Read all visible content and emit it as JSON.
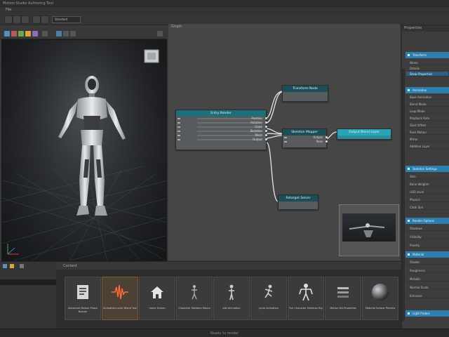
{
  "window": {
    "title": "Motion Studio Authoring Tool"
  },
  "menu": {
    "first_item": "File"
  },
  "toolbar": {
    "layout_value": "Standard"
  },
  "graph": {
    "tab_label": "Graph",
    "nodes": [
      {
        "id": "main",
        "title": "Entry Render"
      },
      {
        "id": "top",
        "title": "Transform Node"
      },
      {
        "id": "mid",
        "title": "Skeleton Mapper"
      },
      {
        "id": "out",
        "title": "Output Blend Layer"
      },
      {
        "id": "bottom",
        "title": "Retarget Solver"
      }
    ],
    "main_pins": [
      "Position",
      "Rotation",
      "Scale",
      "Skeleton",
      "Mesh",
      "Output"
    ],
    "mid_pins": [
      "Output",
      "Pose"
    ]
  },
  "viewport": {
    "label": "Perspective"
  },
  "properties": {
    "title": "Properties",
    "sections": [
      {
        "label": "Transform",
        "props": [
          "Name",
          "Details",
          "Show Properties"
        ]
      },
      {
        "label": "Animation",
        "props": [
          "Base Animation",
          "Blend Mode",
          "Loop Mode",
          "Playback Rate",
          "Start Offset",
          "Root Motion",
          "Mirror",
          "Additive Layer"
        ]
      },
      {
        "label": "Skeleton Settings",
        "props": [
          "Skin",
          "Bone Weights",
          "LOD Level",
          "Physics",
          "Cloth Sim"
        ]
      },
      {
        "label": "Render Options",
        "props": [
          "Shadows",
          "Visibility",
          "Priority"
        ]
      },
      {
        "label": "Material",
        "props": [
          "Shader",
          "Roughness",
          "Metallic",
          "Normal Scale",
          "Emissive"
        ]
      },
      {
        "label": "Light Probes",
        "props": []
      }
    ]
  },
  "content": {
    "header": "Content",
    "tiles": [
      {
        "caption": "Advanced Motion Phase Builder",
        "icon": "document-icon",
        "selected": false
      },
      {
        "caption": "Animation Layer Blend Tool",
        "icon": "waveform-icon",
        "selected": true
      },
      {
        "caption": "Home Screen",
        "icon": "home-icon",
        "selected": false
      },
      {
        "caption": "Character Skeleton Mount",
        "icon": "skeleton-icon",
        "selected": false
      },
      {
        "caption": "Idle Animation",
        "icon": "figure-icon",
        "selected": false
      },
      {
        "caption": "Jump Animation",
        "icon": "jump-figure-icon",
        "selected": false
      },
      {
        "caption": "Full Character Skeleton Rig",
        "icon": "full-skeleton-icon",
        "selected": false
      },
      {
        "caption": "Motion Set Properties",
        "icon": "properties-icon",
        "selected": false
      },
      {
        "caption": "Material Sphere Preview",
        "icon": "sphere-icon",
        "selected": false
      }
    ]
  },
  "status": {
    "text": "Ready to render"
  },
  "colors": {
    "node_header": "#1f6f7a",
    "section_header": "#2f7fae",
    "selected_tile": "#7b5a3e"
  }
}
